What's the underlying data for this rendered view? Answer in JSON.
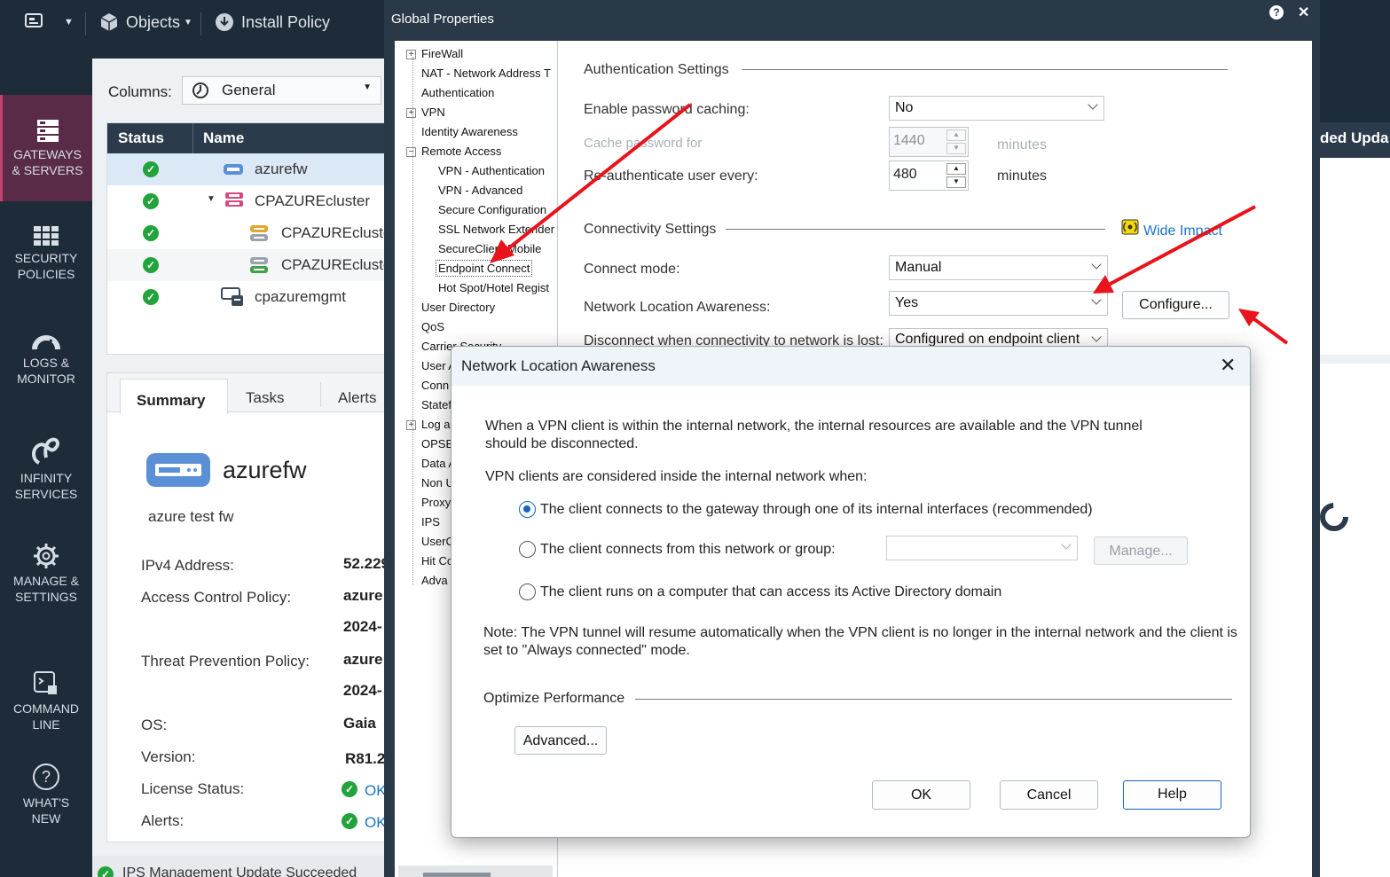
{
  "topbar": {
    "objects_label": "Objects",
    "install_label": "Install Policy"
  },
  "leftnav": {
    "items": [
      {
        "label1": "GATEWAYS",
        "label2": "& SERVERS"
      },
      {
        "label1": "SECURITY",
        "label2": "POLICIES"
      },
      {
        "label1": "LOGS &",
        "label2": "MONITOR"
      },
      {
        "label1": "INFINITY",
        "label2": "SERVICES"
      },
      {
        "label1": "MANAGE &",
        "label2": "SETTINGS"
      },
      {
        "label1": "COMMAND",
        "label2": "LINE"
      },
      {
        "label1": "WHAT'S",
        "label2": "NEW"
      }
    ]
  },
  "main": {
    "columns_label": "Columns:",
    "columns_value": "General",
    "grid": {
      "headers": [
        "Status",
        "Name"
      ],
      "rows": [
        {
          "name": "azurefw"
        },
        {
          "name": "CPAZUREcluster"
        },
        {
          "name": "CPAZUREcluste"
        },
        {
          "name": "CPAZUREcluste"
        },
        {
          "name": "cpazuremgmt"
        }
      ]
    },
    "right_header_fragment": "ded Upda",
    "tabs": [
      "Summary",
      "Tasks",
      "Alerts"
    ],
    "details": {
      "name": "azurefw",
      "comment": "azure test fw",
      "ipv4_label": "IPv4 Address:",
      "ipv4_value": "52.229",
      "acp_label": "Access Control Policy:",
      "acp_value": "azure",
      "acp_date": "2024-",
      "tpp_label": "Threat Prevention Policy:",
      "tpp_value": "azure",
      "tpp_date": "2024-",
      "os_label": "OS:",
      "os_value": "Gaia",
      "version_label": "Version:",
      "version_value": "R81.2",
      "license_label": "License Status:",
      "license_value": "OK",
      "alerts_label": "Alerts:",
      "alerts_value": "OK"
    },
    "statusbar": "IPS Management Update Succeeded"
  },
  "global_properties": {
    "title": "Global Properties",
    "tree": [
      "FireWall",
      "NAT - Network Address T",
      "Authentication",
      "VPN",
      "Identity Awareness",
      "Remote Access",
      "VPN - Authentication",
      "VPN - Advanced",
      "Secure Configuration",
      "SSL Network Extender",
      "SecureClient Mobile",
      "Endpoint Connect",
      "Hot Spot/Hotel Regist",
      "User Directory",
      "QoS",
      "Carrier Security",
      "User A",
      "Conn",
      "Statef",
      "Log a",
      "OPSE",
      "Data A",
      "Non U",
      "Proxy",
      "IPS",
      "UserC",
      "Hit Co",
      "Adva"
    ],
    "auth_section": "Authentication Settings",
    "pw_cache_label": "Enable password caching:",
    "pw_cache_value": "No",
    "cache_for_label": "Cache password for",
    "cache_for_value": "1440",
    "minutes1": "minutes",
    "reauth_label": "Re-authenticate user every:",
    "reauth_value": "480",
    "minutes2": "minutes",
    "conn_section": "Connectivity Settings",
    "wide_impact": "Wide Impact",
    "connect_mode_label": "Connect mode:",
    "connect_mode_value": "Manual",
    "nla_label": "Network Location Awareness:",
    "nla_value": "Yes",
    "configure_label": "Configure...",
    "disconnect_label": "Disconnect when connectivity to network is lost:",
    "disconnect_value": "Configured on endpoint client"
  },
  "nla_dialog": {
    "title": "Network Location Awareness",
    "intro": "When a VPN client is within the internal network, the internal resources are available and the VPN tunnel should be disconnected.",
    "considered": "VPN clients are considered inside the internal network when:",
    "options": [
      "The client connects to the gateway through one of its internal interfaces (recommended)",
      "The client connects from this network or group:",
      "The client runs on a computer that can access its Active Directory domain"
    ],
    "manage_label": "Manage...",
    "note": "Note: The VPN tunnel will resume automatically when the VPN client is no longer in the internal network and the client is set to \"Always connected\" mode.",
    "optimize_section": "Optimize Performance",
    "advanced_label": "Advanced...",
    "ok_label": "OK",
    "cancel_label": "Cancel",
    "help_label": "Help"
  },
  "colors": {
    "accent_red": "#e8131b",
    "nav_bg": "#1e2b38",
    "header_bg": "#2b3b4b",
    "status_green": "#22a33b",
    "link_blue": "#1a73c8"
  }
}
